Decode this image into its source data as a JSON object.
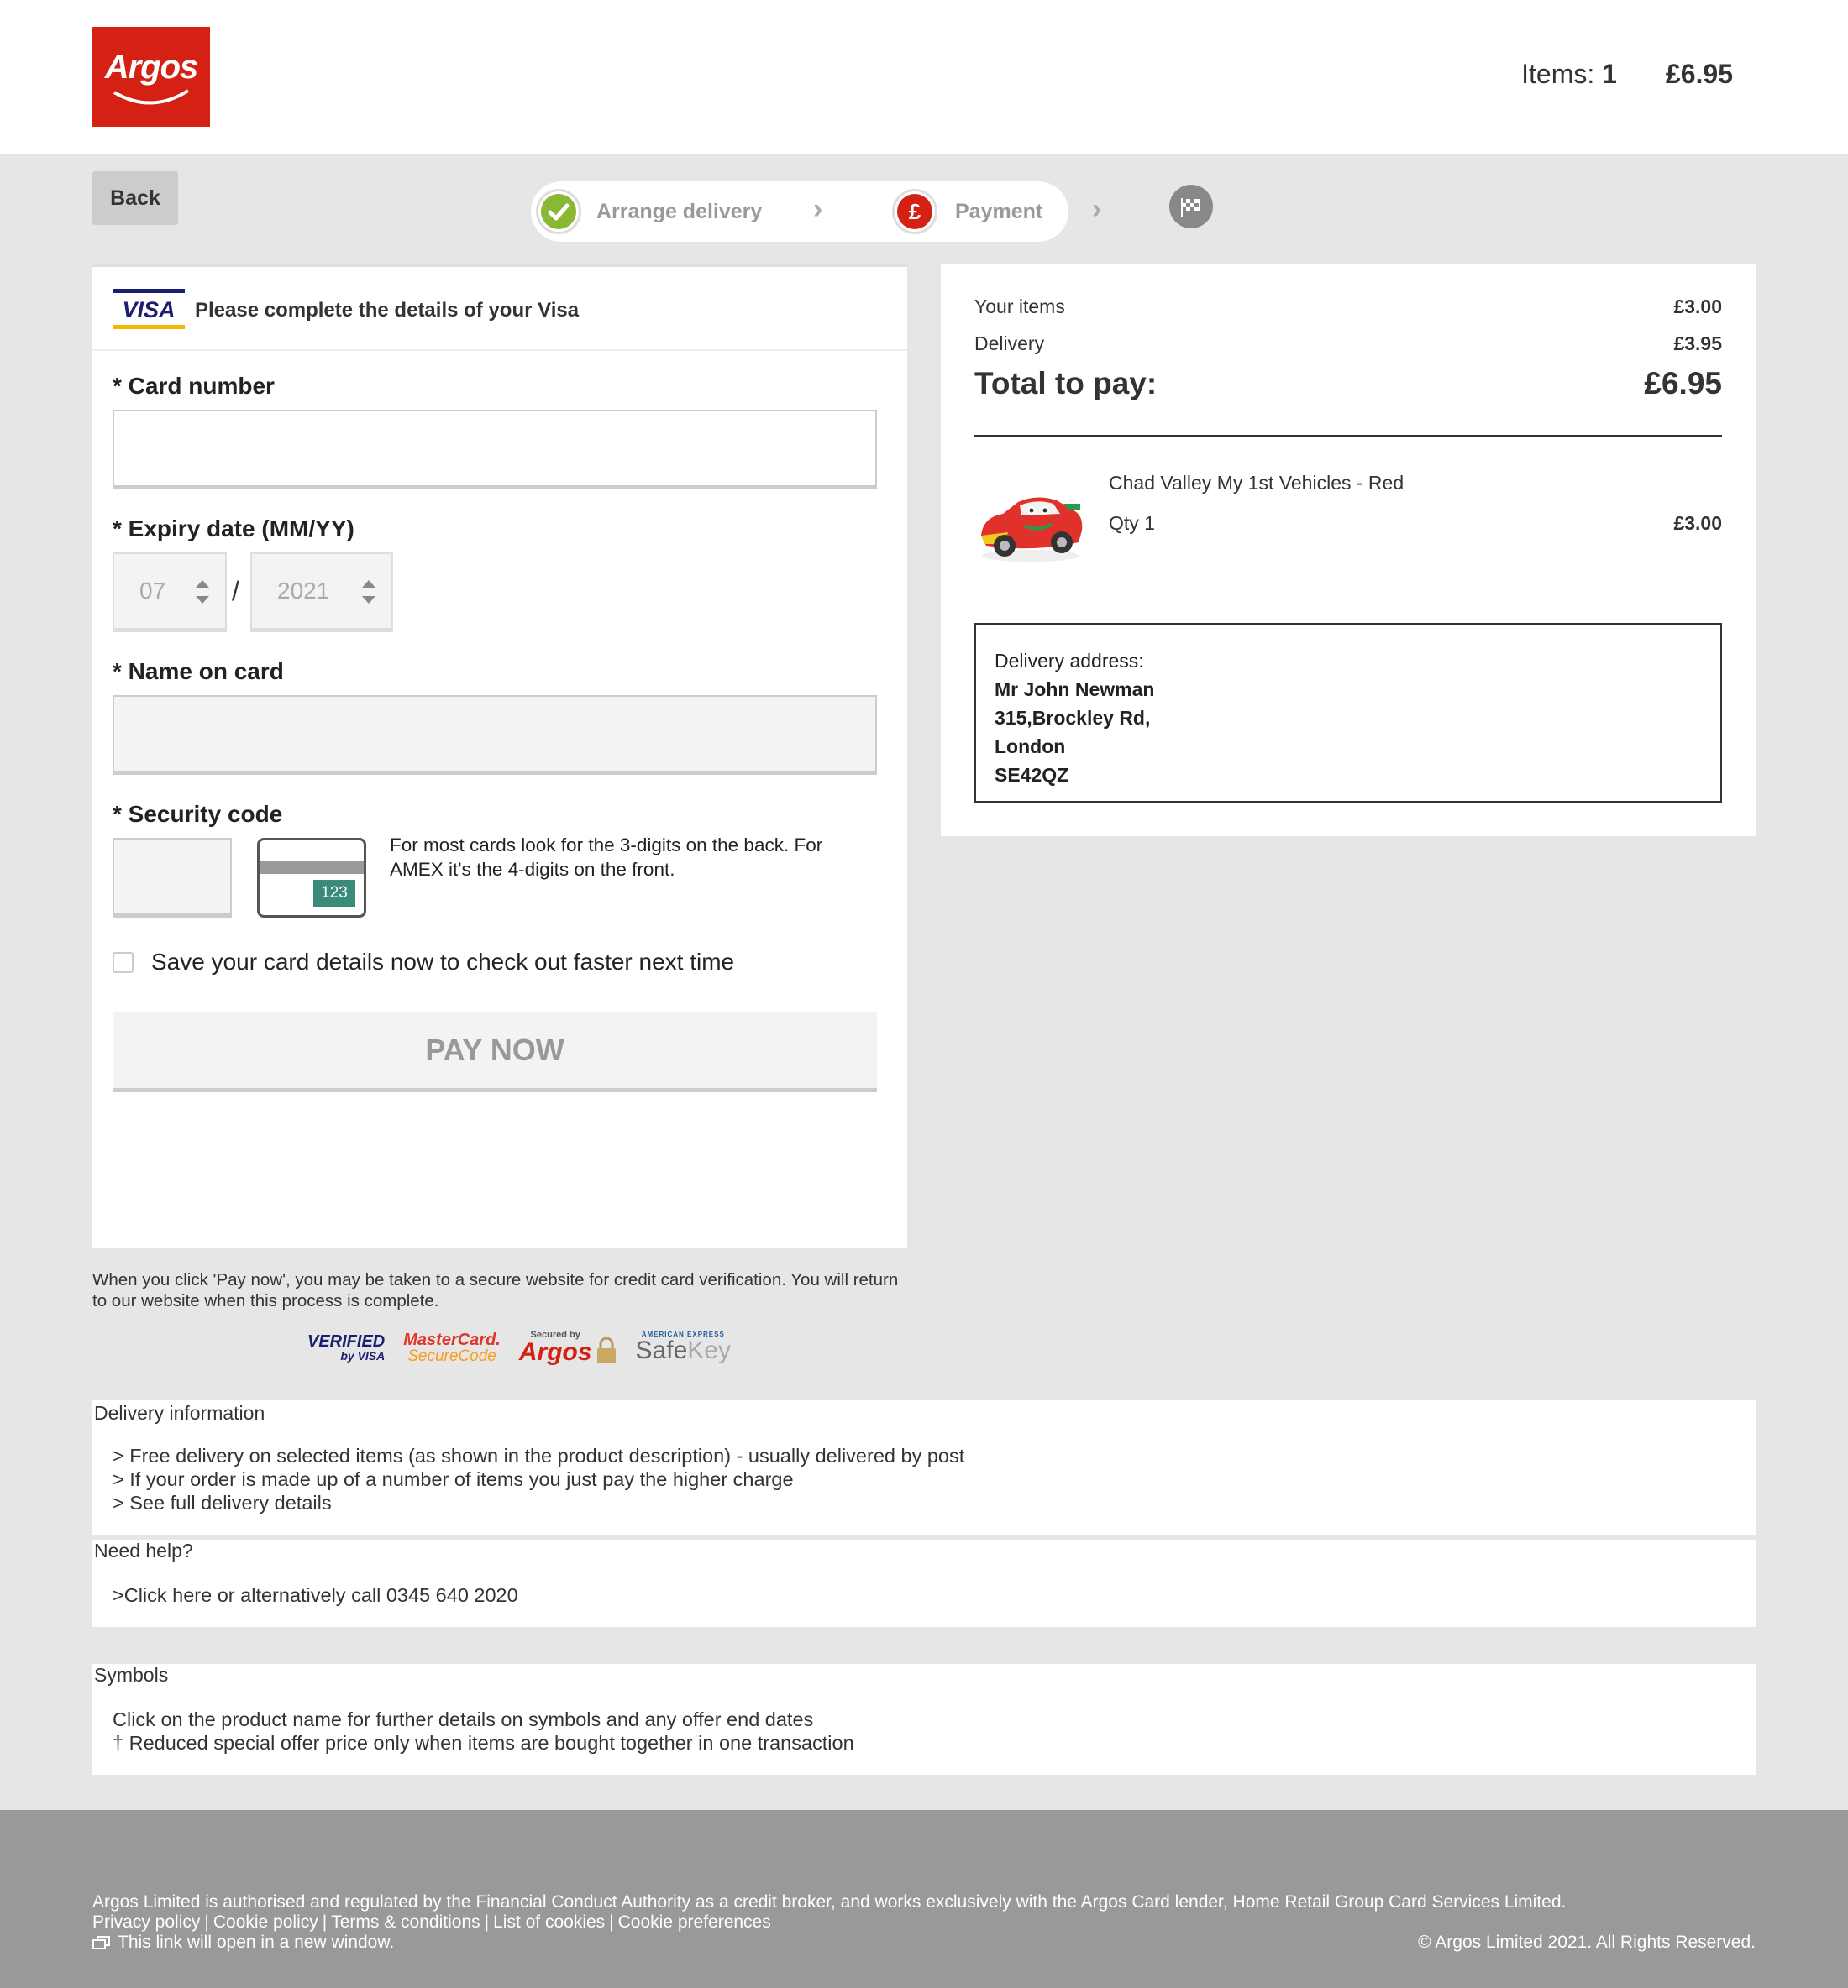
{
  "header": {
    "logo_text": "Argos",
    "items_label": "Items:",
    "items_count": "1",
    "basket_total": "£6.95"
  },
  "nav": {
    "back_label": "Back",
    "steps": [
      {
        "label": "Arrange delivery",
        "state": "complete"
      },
      {
        "label": "Payment",
        "state": "current"
      },
      {
        "label": "",
        "state": "finish"
      }
    ]
  },
  "payment_form": {
    "card_brand": "VISA",
    "intro": "Please complete the details of your Visa",
    "card_number_label": "* Card number",
    "card_number_value": "",
    "expiry_label": "* Expiry date (MM/YY)",
    "expiry_month": "07",
    "expiry_separator": "/",
    "expiry_year": "2021",
    "name_label": "* Name on card",
    "name_value": "",
    "security_label": "* Security code",
    "security_value": "",
    "security_card_digits": "123",
    "security_help": "For most cards look for the 3-digits on the back. For AMEX it's the 4-digits on the front.",
    "save_card_label": "Save your card details now to check out faster next time",
    "save_card_checked": false,
    "pay_button": "PAY NOW"
  },
  "secure_note": "When you click 'Pay now', you may be taken to a secure website for credit card verification. You will return to our website when this process is complete.",
  "security_badges": {
    "verified_visa_1": "VERIFIED",
    "verified_visa_2": "by VISA",
    "mastercard_1": "MasterCard.",
    "mastercard_2": "SecureCode",
    "argos_secured_small": "Secured by",
    "argos_secured": "Argos",
    "amex_small": "AMERICAN EXPRESS",
    "amex_safe": "Safe",
    "amex_key": "Key"
  },
  "summary": {
    "your_items_label": "Your items",
    "your_items_value": "£3.00",
    "delivery_label": "Delivery",
    "delivery_value": "£3.95",
    "total_label": "Total to pay:",
    "total_value": "£6.95",
    "product_name": "Chad Valley My 1st Vehicles - Red",
    "product_qty": "Qty 1",
    "product_price": "£3.00",
    "address_label": "Delivery address:",
    "address_name": "Mr John Newman",
    "address_line1": "315,Brockley Rd,",
    "address_city": "London",
    "address_postcode": "SE42QZ"
  },
  "info": {
    "delivery_title": "Delivery information",
    "delivery_lines": [
      "> Free delivery on selected items (as shown in the product description) - usually delivered by post",
      "> If your order is made up of a number of items you just pay the higher charge",
      "> See full delivery details"
    ],
    "help_title": "Need help?",
    "help_line": ">Click here or alternatively call 0345 640 2020",
    "symbols_title": "Symbols",
    "symbols_lines": [
      "Click on the product name for further details on symbols and any offer end dates",
      "† Reduced special offer price only when items are bought together in one transaction"
    ]
  },
  "footer": {
    "regulation": "Argos Limited is authorised and regulated by the Financial Conduct Authority as a credit broker, and works exclusively with the Argos Card lender, Home Retail Group Card Services Limited.",
    "links": [
      "Privacy policy",
      "Cookie policy",
      "Terms & conditions",
      "List of cookies",
      "Cookie preferences"
    ],
    "separator": "|",
    "new_window_note": "This link will open in a new window.",
    "copyright": "© Argos Limited 2021. All Rights Reserved."
  },
  "colors": {
    "brand_red": "#d42114",
    "step_complete": "#8ab832",
    "step_current": "#d42114",
    "page_bg": "#e6e6e6",
    "footer_bg": "#999999"
  }
}
